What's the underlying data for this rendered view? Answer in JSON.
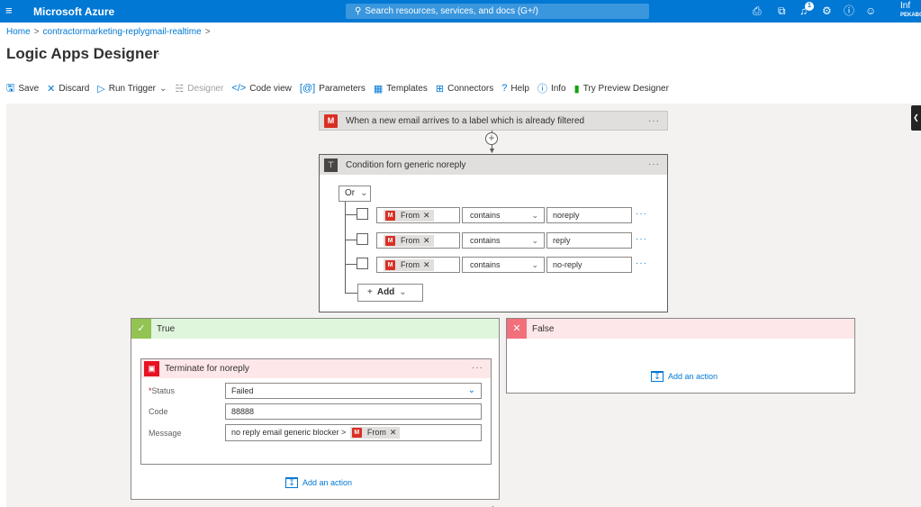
{
  "topbar": {
    "menu_icon": "hamburger-icon",
    "brand": "Microsoft Azure",
    "search_placeholder": "Search resources, services, and docs (G+/)",
    "icons": [
      "cloud-shell-icon",
      "directory-filter-icon",
      "notifications-icon",
      "settings-icon",
      "help-icon",
      "feedback-icon"
    ],
    "notification_count": "1",
    "account_line1": "Inf",
    "account_line2": "PEKABO"
  },
  "breadcrumb": {
    "home": "Home",
    "item": "contractormarketing-replygmail-realtime"
  },
  "page": {
    "title": "Logic Apps Designer",
    "more": "···"
  },
  "toolbar": {
    "save": "Save",
    "discard": "Discard",
    "run_trigger": "Run Trigger",
    "designer": "Designer",
    "code_view": "Code view",
    "parameters": "Parameters",
    "templates": "Templates",
    "connectors": "Connectors",
    "help": "Help",
    "info": "Info",
    "try_preview": "Try Preview Designer"
  },
  "trigger": {
    "title": "When a new email arrives to a label which is already filtered",
    "more": "···"
  },
  "condition": {
    "title": "Condition forn generic noreply",
    "more": "···",
    "group_operator": "Or",
    "rows": [
      {
        "token": "From",
        "operator": "contains",
        "value": "noreply"
      },
      {
        "token": "From",
        "operator": "contains",
        "value": "reply"
      },
      {
        "token": "From",
        "operator": "contains",
        "value": "no-reply"
      }
    ],
    "add_label": "Add"
  },
  "true_branch": {
    "label": "True",
    "terminate": {
      "title": "Terminate for noreply",
      "more": "···",
      "status_label": "Status",
      "status_value": "Failed",
      "code_label": "Code",
      "code_value": "88888",
      "message_label": "Message",
      "message_text": "no reply email generic blocker >",
      "message_token": "From"
    },
    "add_action": "Add an action"
  },
  "false_branch": {
    "label": "False",
    "add_action": "Add an action"
  },
  "colors": {
    "azure_blue": "#0078d4",
    "gmail_red": "#d93025",
    "true_green": "#92c353",
    "false_red": "#f1707b",
    "terminate_red": "#e81123"
  }
}
